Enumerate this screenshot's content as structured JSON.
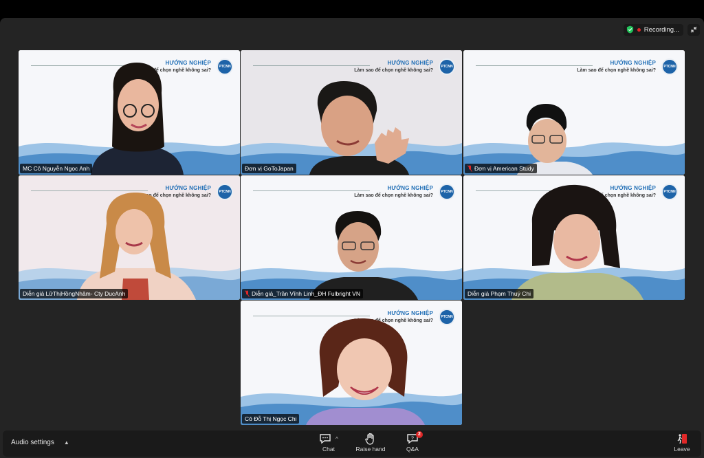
{
  "recording": {
    "label": "Recording..."
  },
  "brand": {
    "title": "HƯỚNG NGHIỆP",
    "subtitle": "Làm sao để chọn nghề không sai?",
    "logo": "PTCNN"
  },
  "participants": [
    {
      "name": "MC Cô Nguyễn Ngọc Anh",
      "muted": false
    },
    {
      "name": "Đơn vị GoToJapan",
      "muted": false
    },
    {
      "name": "Đơn vị American Study",
      "muted": true
    },
    {
      "name": "Diễn giả LữThịHồngNhâm- Cty DucAnh",
      "muted": false
    },
    {
      "name": "Diễn giả_Trần Vĩnh Linh_ĐH Fulbright VN",
      "muted": true
    },
    {
      "name": "Diễn giả Phạm Thuý Chi",
      "muted": false
    },
    {
      "name": "Cô Đỗ Thị Ngọc Chi",
      "muted": false
    }
  ],
  "toolbar": {
    "audio_settings": "Audio settings",
    "chat": "Chat",
    "raise_hand": "Raise hand",
    "qa": "Q&A",
    "qa_badge": "2",
    "leave": "Leave"
  },
  "colors": {
    "active_speaker": "#23d959",
    "record": "#e02828",
    "brand_blue": "#1e6db5"
  }
}
